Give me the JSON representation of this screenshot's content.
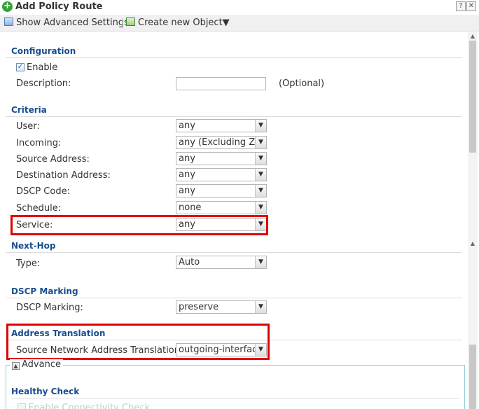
{
  "window": {
    "title": "Add Policy Route",
    "help_label": "?",
    "close_label": "✕",
    "title_icon": "plus-circle-icon"
  },
  "toolbar": {
    "show_advanced_label": "Show Advanced Settings",
    "create_object_label": "Create new Object▼"
  },
  "configuration": {
    "heading": "Configuration",
    "enable_label": "Enable",
    "enable_checked": true,
    "description_label": "Description:",
    "description_value": "",
    "optional_label": "(Optional)"
  },
  "criteria": {
    "heading": "Criteria",
    "user_label": "User:",
    "user_value": "any",
    "incoming_label": "Incoming:",
    "incoming_value": "any (Excluding ZyW",
    "source_label": "Source Address:",
    "source_value": "any",
    "destination_label": "Destination Address:",
    "destination_value": "any",
    "dscp_label": "DSCP Code:",
    "dscp_value": "any",
    "schedule_label": "Schedule:",
    "schedule_value": "none",
    "service_label": "Service:",
    "service_value": "any"
  },
  "next_hop": {
    "heading": "Next-Hop",
    "type_label": "Type:",
    "type_value": "Auto"
  },
  "dscp_marking": {
    "heading": "DSCP Marking",
    "label": "DSCP Marking:",
    "value": "preserve"
  },
  "address_translation": {
    "heading": "Address Translation",
    "snat_label": "Source Network Address Translation:",
    "snat_value": "outgoing-interface"
  },
  "advance": {
    "legend": "Advance",
    "healthy_check_heading": "Healthy Check",
    "enable_connectivity_label": "Enable Connectivity Check"
  },
  "colors": {
    "section_heading": "#1a4d8f",
    "highlight": "#e00000",
    "fieldset_border": "#8fd0dc"
  }
}
